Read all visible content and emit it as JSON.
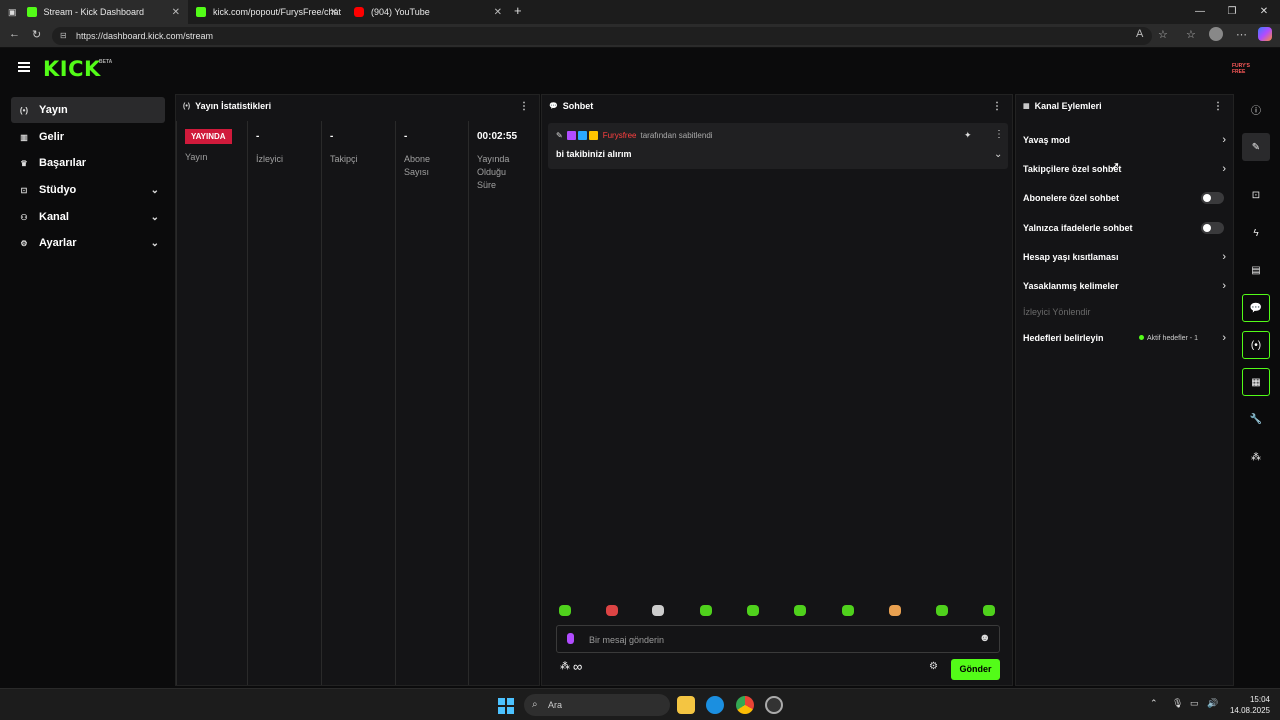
{
  "browser": {
    "tabs": [
      {
        "title": "Stream - Kick Dashboard",
        "icon": "kick-favicon"
      },
      {
        "title": "kick.com/popout/FurysFree/chat",
        "icon": "kick-favicon"
      },
      {
        "title": "(904) YouTube",
        "icon": "youtube-favicon"
      }
    ],
    "url": "https://dashboard.kick.com/stream"
  },
  "header": {
    "logo": "KICK",
    "beta": "BETA",
    "avatar_text": "FURY'S FREE"
  },
  "sidebar": {
    "items": [
      {
        "label": "Yayın",
        "icon": "broadcast-icon"
      },
      {
        "label": "Gelir",
        "icon": "chart-icon"
      },
      {
        "label": "Başarılar",
        "icon": "trophy-icon"
      },
      {
        "label": "Stüdyo",
        "icon": "studio-icon"
      },
      {
        "label": "Kanal",
        "icon": "channel-icon"
      },
      {
        "label": "Ayarlar",
        "icon": "gear-icon"
      }
    ]
  },
  "stats": {
    "title": "Yayın İstatistikleri",
    "live_badge": "YAYINDA",
    "columns": [
      {
        "value": "",
        "label": "Yayın"
      },
      {
        "value": "-",
        "label": "İzleyici"
      },
      {
        "value": "-",
        "label": "Takipçi"
      },
      {
        "value": "-",
        "label": "Abone Sayısı"
      },
      {
        "value": "00:02:55",
        "label": "Yayında Olduğu Süre"
      }
    ]
  },
  "chat": {
    "title": "Sohbet",
    "pinned_user": "Furysfree",
    "pinned_suffix": "tarafından sabitlendi",
    "pinned_message": "bi takibinizi alırım",
    "input_placeholder": "Bir mesaj gönderin",
    "send_label": "Gönder",
    "infinity": "∞"
  },
  "actions": {
    "title": "Kanal Eylemleri",
    "items": [
      {
        "label": "Yavaş mod",
        "type": "chevron"
      },
      {
        "label": "Takipçilere özel sohbet",
        "type": "chevron"
      },
      {
        "label": "Abonelere özel sohbet",
        "type": "toggle"
      },
      {
        "label": "Yalnızca ifadelerle sohbet",
        "type": "toggle"
      },
      {
        "label": "Hesap yaşı kısıtlaması",
        "type": "chevron"
      },
      {
        "label": "Yasaklanmış kelimeler",
        "type": "chevron"
      }
    ],
    "section_label": "İzleyici Yönlendir",
    "goals_label": "Hedefleri belirleyin",
    "goals_status": "Aktif hedefler - 1"
  },
  "taskbar": {
    "search": "Ara",
    "time": "15:04",
    "date": "14.08.2025"
  },
  "colors": {
    "accent": "#53fc18",
    "live": "#d01a3b"
  }
}
